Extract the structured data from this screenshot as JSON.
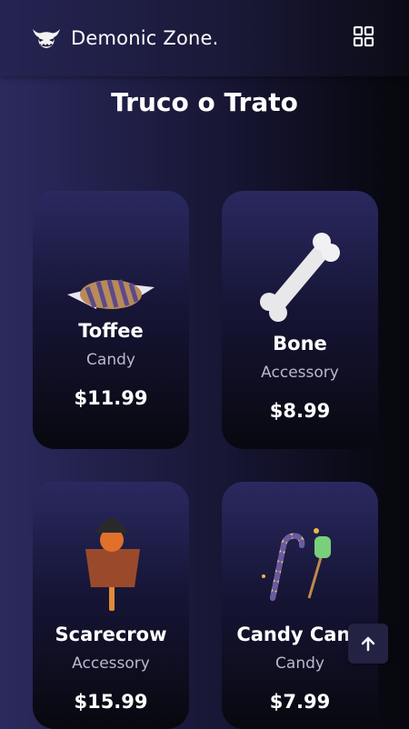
{
  "header": {
    "brand": "Demonic Zone.",
    "logo_icon": "demon-face-icon",
    "menu_icon": "grid-menu-icon"
  },
  "page_title": "Truco o Trato",
  "products": [
    {
      "name": "Toffee",
      "category": "Candy",
      "price": "$11.99",
      "icon": "toffee-icon"
    },
    {
      "name": "Bone",
      "category": "Accessory",
      "price": "$8.99",
      "icon": "bone-icon"
    },
    {
      "name": "Scarecrow",
      "category": "Accessory",
      "price": "$15.99",
      "icon": "scarecrow-icon"
    },
    {
      "name": "Candy Cane",
      "category": "Candy",
      "price": "$7.99",
      "icon": "candy-cane-icon"
    }
  ],
  "scroll_top_icon": "arrow-up-icon",
  "colors": {
    "accent_purple": "#2b2a5e",
    "card_dark": "#08080f",
    "text_muted": "#b9b8cc"
  }
}
